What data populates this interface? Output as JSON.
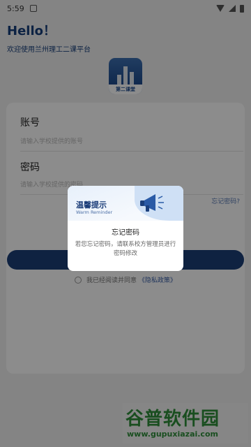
{
  "status_bar": {
    "time": "5:59",
    "notification_icon": "app-notification-icon"
  },
  "greeting": {
    "hello": "Hello！",
    "subtitle": "欢迎使用兰州理工二课平台"
  },
  "logo": {
    "caption": "第二课堂"
  },
  "login": {
    "account_label": "账号",
    "account_placeholder": "请输入学校提供的账号",
    "password_label": "密码",
    "password_placeholder": "请输入学校提供的密码",
    "forgot_link": "忘记密码?",
    "login_button": "",
    "agree_text": "我已经阅读并同意",
    "privacy_link": "《隐私政策》"
  },
  "dialog": {
    "title": "温馨提示",
    "subtitle": "Warm Reminder",
    "message_title": "忘记密码",
    "message": "若您忘记密码，请联系校方管理员进行密码修改"
  },
  "watermark": {
    "text": "谷普软件园",
    "url": "www.gupuxiazai.com"
  },
  "colors": {
    "primary": "#1c3f77",
    "accent_green": "#2f8e3a"
  }
}
